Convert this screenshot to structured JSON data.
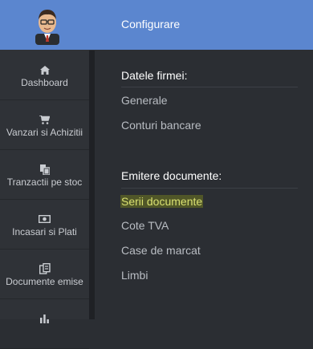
{
  "header": {
    "title": "Configurare"
  },
  "sidebar": {
    "avatar_icon": "user-avatar-icon",
    "items": [
      {
        "label": "Dashboard",
        "icon": "home-icon"
      },
      {
        "label": "Vanzari si Achizitii",
        "icon": "cart-icon"
      },
      {
        "label": "Tranzactii pe stoc",
        "icon": "copy-icon"
      },
      {
        "label": "Incasari si Plati",
        "icon": "money-icon"
      },
      {
        "label": "Documente emise",
        "icon": "documents-icon"
      },
      {
        "label": "",
        "icon": "chart-icon"
      }
    ]
  },
  "sections": [
    {
      "title": "Datele firmei:",
      "links": [
        "Generale",
        "Conturi bancare"
      ]
    },
    {
      "title": "Emitere documente:",
      "links": [
        "Serii documente",
        "Cote TVA",
        "Case de marcat",
        "Limbi"
      ]
    }
  ],
  "active_link": "Serii documente",
  "colors": {
    "accent": "#5b86cf",
    "background": "#2b2e33",
    "highlight_text": "#d9e070",
    "highlight_bg": "#6b6f1f"
  }
}
